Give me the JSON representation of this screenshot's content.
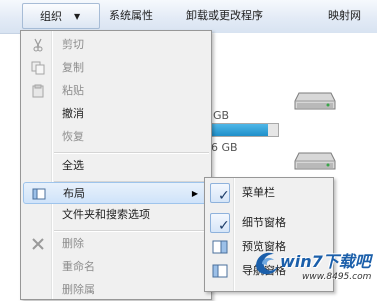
{
  "toolbar": {
    "organize_label": "组织",
    "organize_arrow": "▼",
    "system_properties": "系统属性",
    "uninstall_change": "卸载或更改程序",
    "map_network": "映射网"
  },
  "background": {
    "drive1_size": "GB",
    "drive2_size": "6 GB",
    "drive2_usage_fraction": 0.85,
    "drive_icon": "hard-drive-icon"
  },
  "menu": {
    "items": [
      {
        "label": "剪切",
        "icon": "scissors-icon",
        "disabled": true
      },
      {
        "label": "复制",
        "icon": "copy-icon",
        "disabled": true
      },
      {
        "label": "粘贴",
        "icon": "paste-icon",
        "disabled": true
      },
      {
        "label": "撤消",
        "icon": "",
        "disabled": false
      },
      {
        "label": "恢复",
        "icon": "",
        "disabled": true
      },
      {
        "label": "全选",
        "icon": "",
        "disabled": false
      },
      {
        "label": "布局",
        "icon": "layout-icon",
        "disabled": false,
        "submenu_arrow": "▶"
      },
      {
        "label": "文件夹和搜索选项",
        "icon": "",
        "disabled": false
      },
      {
        "label": "删除",
        "icon": "delete-x-icon",
        "disabled": true
      },
      {
        "label": "重命名",
        "icon": "",
        "disabled": true
      },
      {
        "label": "删除属",
        "icon": "",
        "disabled": true
      }
    ]
  },
  "submenu": {
    "items": [
      {
        "label": "菜单栏",
        "checked": true,
        "icon": "check-icon"
      },
      {
        "label": "细节窗格",
        "checked": true,
        "icon": "check-icon"
      },
      {
        "label": "预览窗格",
        "checked": false,
        "icon": "preview-pane-icon"
      },
      {
        "label": "导航窗格",
        "checked": false,
        "icon": "navigation-pane-icon"
      }
    ],
    "check_glyph": "✓"
  },
  "watermark": {
    "brand": "win7下载吧",
    "url": "www.8495.com"
  },
  "colors": {
    "menu_bg": "#f0f0f0",
    "hover_bg": "#cfe3fa",
    "bar_fill": "#1f8fc9",
    "brand_blue": "#1b5faa"
  }
}
